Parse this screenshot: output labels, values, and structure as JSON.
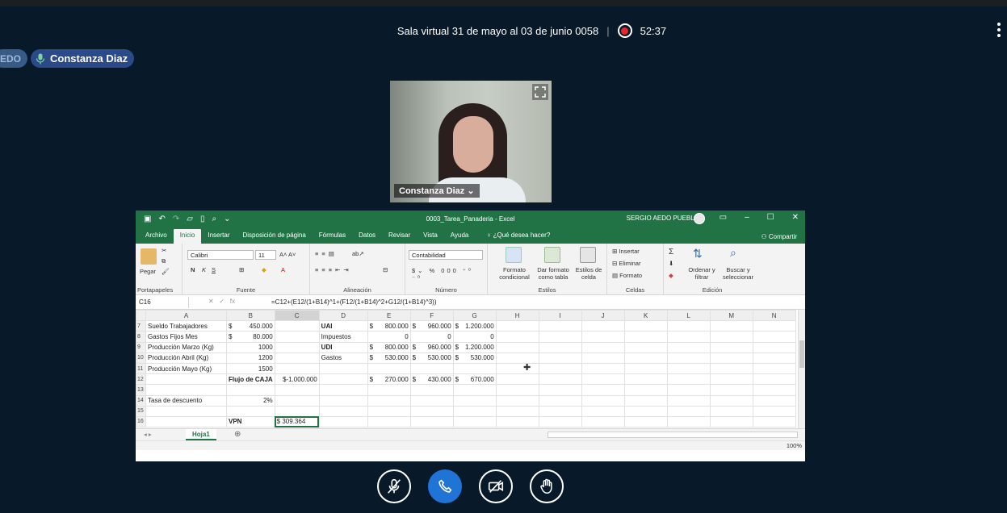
{
  "meeting": {
    "title": "Sala virtual 31 de mayo al 03 de junio 0058",
    "separator": "|",
    "timer": "52:37",
    "participant_chip_left": "EDO",
    "participant_chip_main": "Constanza Diaz",
    "speaker_name": "Constanza Diaz ⌄"
  },
  "excel": {
    "file_title": "0003_Tarea_Panaderia  -  Excel",
    "user": "SERGIO AEDO PUEBLA",
    "tabs": [
      "Archivo",
      "Inicio",
      "Insertar",
      "Disposición de página",
      "Fórmulas",
      "Datos",
      "Revisar",
      "Vista",
      "Ayuda"
    ],
    "help_search": "¿Qué desea hacer?",
    "share": "Compartir",
    "ribbon": {
      "paste": "Pegar",
      "font_name": "Calibri",
      "font_size": "11",
      "number_format": "Contabilidad",
      "cond_format": "Formato condicional",
      "table_format": "Dar formato como tabla",
      "cell_styles": "Estilos de celda",
      "insert": "Insertar",
      "delete": "Eliminar",
      "format": "Formato",
      "sort_filter": "Ordenar y filtrar",
      "find_select": "Buscar y seleccionar",
      "groups": [
        "Portapapeles",
        "Fuente",
        "Alineación",
        "Número",
        "Estilos",
        "Celdas",
        "Edición"
      ]
    },
    "name_box": "C16",
    "formula": "=C12+(E12/(1+B14)^1+(F12/(1+B14)^2+G12/(1+B14)^3))",
    "columns": [
      "A",
      "B",
      "C",
      "D",
      "E",
      "F",
      "G",
      "H",
      "I",
      "J",
      "K",
      "L",
      "M",
      "N"
    ],
    "rows": [
      {
        "n": "7",
        "A": "Sueldo Trabajadores",
        "B_sym": "$",
        "B": "450.000",
        "C": "",
        "D": "UAI",
        "D_bold": true,
        "E_sym": "$",
        "E": "800.000",
        "F_sym": "$",
        "F": "960.000",
        "G_sym": "$",
        "G": "1.200.000"
      },
      {
        "n": "8",
        "A": "Gastos Fijos Mes",
        "B_sym": "$",
        "B": "80.000",
        "C": "",
        "D": "Impuestos",
        "D_bold": false,
        "E_sym": "",
        "E": "0",
        "F_sym": "",
        "F": "0",
        "G_sym": "",
        "G": "0"
      },
      {
        "n": "9",
        "A": "Producción Marzo (Kg)",
        "B_sym": "",
        "B": "1000",
        "C": "",
        "D": "UDI",
        "D_bold": true,
        "E_sym": "$",
        "E": "800.000",
        "F_sym": "$",
        "F": "960.000",
        "G_sym": "$",
        "G": "1.200.000"
      },
      {
        "n": "10",
        "A": "Producción Abril (Kg)",
        "B_sym": "",
        "B": "1200",
        "C": "",
        "D": "Gastos",
        "D_bold": false,
        "E_sym": "$",
        "E": "530.000",
        "F_sym": "$",
        "F": "530.000",
        "G_sym": "$",
        "G": "530.000"
      },
      {
        "n": "11",
        "A": "Producción Mayo (Kg)",
        "B_sym": "",
        "B": "1500",
        "C": "",
        "D": "",
        "D_bold": false,
        "E_sym": "",
        "E": "",
        "F_sym": "",
        "F": "",
        "G_sym": "",
        "G": ""
      },
      {
        "n": "12",
        "A": "",
        "B_sym": "",
        "B": "Flujo de CAJA",
        "C": "$-1.000.000",
        "D": "",
        "D_bold": false,
        "E_sym": "$",
        "E": "270.000",
        "F_sym": "$",
        "F": "430.000",
        "G_sym": "$",
        "G": "670.000"
      },
      {
        "n": "13",
        "A": "",
        "B_sym": "",
        "B": "",
        "C": "",
        "D": "",
        "D_bold": false,
        "E_sym": "",
        "E": "",
        "F_sym": "",
        "F": "",
        "G_sym": "",
        "G": ""
      },
      {
        "n": "14",
        "A": "Tasa de descuento",
        "B_sym": "",
        "B": "2%",
        "C": "",
        "D": "",
        "D_bold": false,
        "E_sym": "",
        "E": "",
        "F_sym": "",
        "F": "",
        "G_sym": "",
        "G": ""
      },
      {
        "n": "15",
        "A": "",
        "B_sym": "",
        "B": "",
        "C": "",
        "D": "",
        "D_bold": false,
        "E_sym": "",
        "E": "",
        "F_sym": "",
        "F": "",
        "G_sym": "",
        "G": ""
      },
      {
        "n": "16",
        "A": "",
        "B_sym": "",
        "B": "VPN",
        "C": "$ 309.364",
        "D": "",
        "D_bold": false,
        "E_sym": "",
        "E": "",
        "F_sym": "",
        "F": "",
        "G_sym": "",
        "G": ""
      }
    ],
    "sheet_tab": "Hoja1",
    "zoom": "100%"
  },
  "controls": [
    "mute-microphone",
    "hang-up",
    "camera-off",
    "raise-hand"
  ],
  "colors": {
    "background": "#08192a",
    "excel_green": "#217346",
    "call_blue": "#1f74d6",
    "record_red": "#e8262b"
  }
}
